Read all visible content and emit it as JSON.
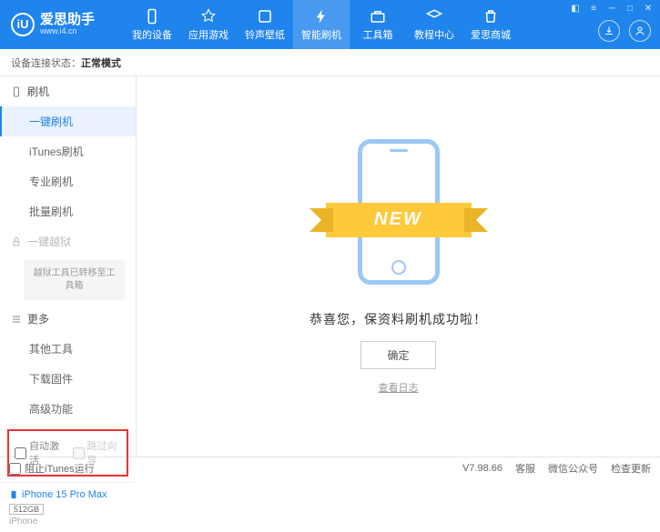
{
  "logo": {
    "glyph": "iU",
    "title": "爱思助手",
    "url": "www.i4.cn"
  },
  "nav": [
    {
      "label": "我的设备"
    },
    {
      "label": "应用游戏"
    },
    {
      "label": "铃声壁纸"
    },
    {
      "label": "智能刷机",
      "active": true
    },
    {
      "label": "工具箱"
    },
    {
      "label": "教程中心"
    },
    {
      "label": "爱思商城"
    }
  ],
  "status": {
    "label": "设备连接状态：",
    "value": "正常模式"
  },
  "sidebar": {
    "group_flash": "刷机",
    "items_flash": [
      "一键刷机",
      "iTunes刷机",
      "专业刷机",
      "批量刷机"
    ],
    "group_jailbreak": "一键越狱",
    "jailbreak_note": "越狱工具已转移至工具箱",
    "group_more": "更多",
    "items_more": [
      "其他工具",
      "下载固件",
      "高级功能"
    ],
    "check_auto_activate": "自动激活",
    "check_skip_guide": "跳过向导",
    "device": {
      "name": "iPhone 15 Pro Max",
      "capacity": "512GB",
      "type": "iPhone"
    }
  },
  "main": {
    "ribbon": "NEW",
    "message": "恭喜您，保资料刷机成功啦！",
    "ok": "确定",
    "log": "查看日志"
  },
  "footer": {
    "block_itunes": "阻止iTunes运行",
    "version": "V7.98.66",
    "items": [
      "客服",
      "微信公众号",
      "检查更新"
    ]
  }
}
